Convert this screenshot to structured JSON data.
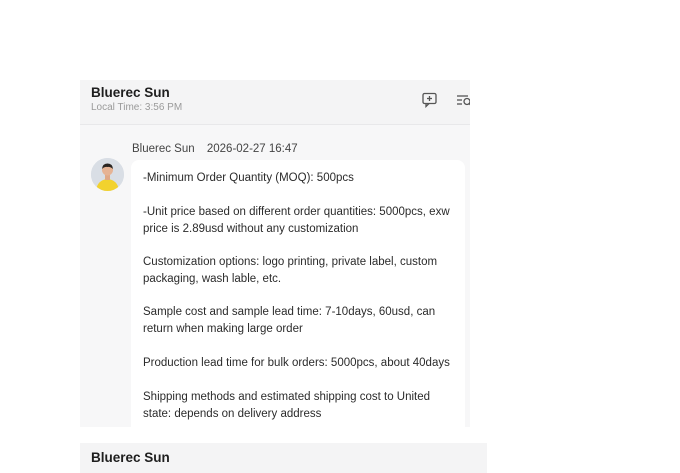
{
  "chat": {
    "contact_name": "Bluerec Sun",
    "local_time": "Local Time: 3:56 PM",
    "message": {
      "sender": "Bluerec Sun",
      "timestamp": "2026-02-27 16:47",
      "lines": [
        "-Minimum Order Quantity (MOQ):    500pcs",
        "-Unit price based on different order quantities: 5000pcs, exw",
        "price is 2.89usd without any customization",
        "Customization options: logo printing, private label, custom",
        "packaging, wash lable, etc.",
        "Sample cost and sample lead time: 7-10days, 60usd, can",
        "return when making large order",
        "Production lead time for bulk orders: 5000pcs, about 40days",
        "Shipping methods and estimated shipping cost to United",
        "state: depends on delivery address"
      ]
    },
    "icons": [
      "add-note-icon",
      "search-list-icon"
    ]
  },
  "next_chat": {
    "contact_name": "Bluerec Sun"
  }
}
